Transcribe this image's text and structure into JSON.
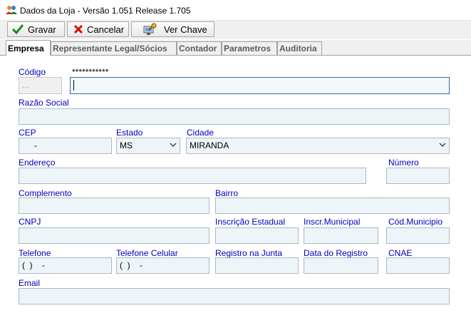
{
  "window": {
    "title": "Dados da Loja - Versão 1.051 Release 1.705"
  },
  "toolbar": {
    "save_label": "Gravar",
    "cancel_label": "Cancelar",
    "key_label": "Ver Chave"
  },
  "tabs": [
    {
      "label": "Empresa",
      "active": true
    },
    {
      "label": "Representante Legal/Sócios"
    },
    {
      "label": "Contador"
    },
    {
      "label": "Parametros"
    },
    {
      "label": "Auditoria"
    }
  ],
  "form": {
    "codigo_label": "Código",
    "codigo_mask": "***********",
    "codigo_value": "...",
    "razao_social_label": "Razão Social",
    "cep_label": "CEP",
    "cep_value": "-",
    "estado_label": "Estado",
    "estado_value": "MS",
    "cidade_label": "Cidade",
    "cidade_value": "MIRANDA",
    "endereco_label": "Endereço",
    "numero_label": "Número",
    "complemento_label": "Complemento",
    "bairro_label": "Bairro",
    "cnpj_label": "CNPJ",
    "inscricao_estadual_label": "Inscrição Estadual",
    "inscr_municipal_label": "Inscr.Municipal",
    "cod_municipio_label": "Cód.Municipio",
    "telefone_label": "Telefone",
    "telefone_value": "(  )    -",
    "telefone_celular_label": "Telefone Celular",
    "telefone_celular_value": "(  )    -",
    "registro_junta_label": "Registro na Junta",
    "data_registro_label": "Data do Registro",
    "cnae_label": "CNAE",
    "email_label": "Email"
  },
  "colors": {
    "label_blue": "#0000c0",
    "field_bg": "#eef5f8",
    "focus_border": "#2b6cb0"
  },
  "icons": [
    "users-icon",
    "check-icon",
    "x-icon",
    "key-computer-icon",
    "chevron-down-icon"
  ]
}
